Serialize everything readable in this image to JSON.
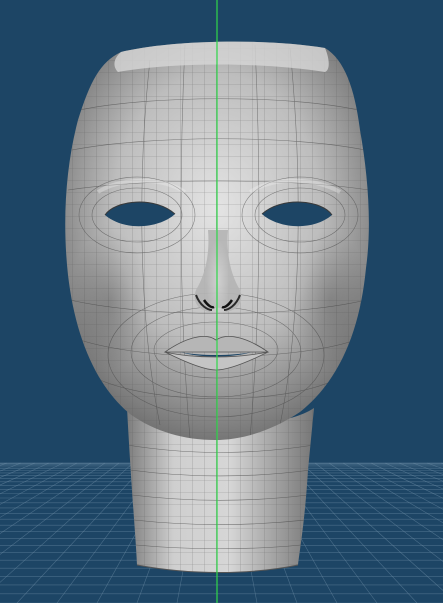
{
  "viewport": {
    "background_color": "#1d4565",
    "grid_color": "#6f8fa8",
    "y_axis_color": "#2fd84a",
    "mesh_fill_color": "#bcbcbc",
    "mesh_wire_color": "#555555",
    "cavity_color": "#1d4565"
  },
  "model": {
    "type": "polygon-mesh",
    "subject": "head-mask",
    "shading": "smooth-with-wireframe"
  }
}
